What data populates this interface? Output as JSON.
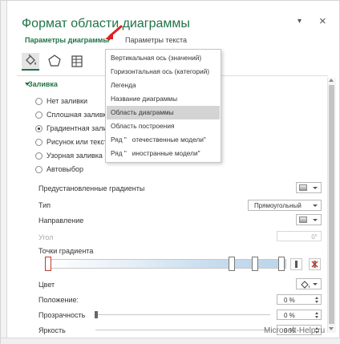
{
  "pane": {
    "title": "Формат области диаграммы",
    "pin_glyph": "▾",
    "close_glyph": "×",
    "tabs": [
      {
        "label": "Параметры диаграммы",
        "active": true
      },
      {
        "label": "Параметры текста",
        "active": false
      }
    ],
    "icon_tabs": [
      "fill-bucket-icon",
      "pentagon-icon",
      "size-properties-icon"
    ]
  },
  "dropdown_menu": {
    "items": [
      {
        "label": "Вертикальная ось (значений)"
      },
      {
        "label": "Горизонтальная ось (категорий)"
      },
      {
        "label": "Легенда"
      },
      {
        "label": "Название диаграммы"
      },
      {
        "label": "Область диаграммы",
        "highlighted": true
      },
      {
        "label": "Область построения"
      },
      {
        "label": "Ряд \"   отечественные модели\""
      },
      {
        "label": "Ряд \"   иностранные модели\""
      }
    ]
  },
  "fill_section": {
    "heading": "Заливка",
    "options": [
      {
        "label": "Нет заливки",
        "checked": false
      },
      {
        "label": "Сплошная заливка",
        "checked": false
      },
      {
        "label": "Градиентная заливка",
        "checked": true
      },
      {
        "label": "Рисунок или текстура",
        "checked": false
      },
      {
        "label": "Узорная заливка",
        "checked": false
      },
      {
        "label": "Автовыбор",
        "checked": false
      }
    ],
    "preset_label": "Предустановленные градиенты",
    "type_label": "Тип",
    "type_value": "Прямоугольный",
    "direction_label": "Направление",
    "angle_label": "Угол",
    "angle_value": "0°",
    "stops_label": "Точки градиента",
    "color_label": "Цвет",
    "position_label": "Положение:",
    "position_value": "0 %",
    "transparency_label": "Прозрачность",
    "transparency_value": "0 %",
    "brightness_label": "Яркость",
    "brightness_value": "0 %"
  },
  "colors": {
    "accent": "#217346",
    "highlight": "#d4d4d4",
    "annotation_arrow": "#e02020"
  },
  "watermark": "Microsoft-Help.ru"
}
